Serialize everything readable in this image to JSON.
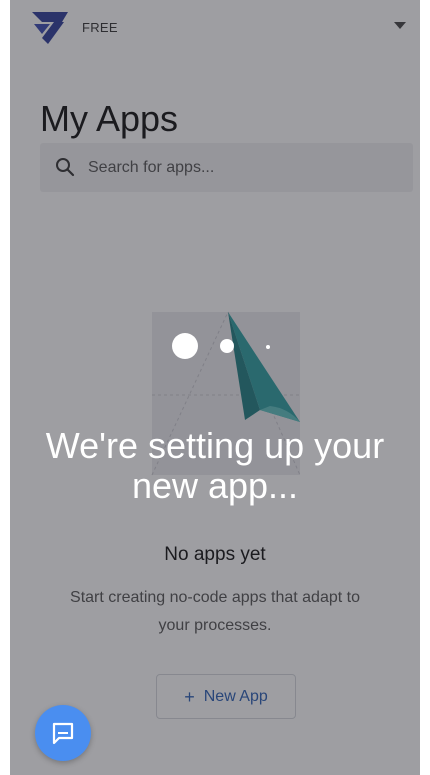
{
  "header": {
    "plan_label": "FREE",
    "logo_icon": "app-logo-icon",
    "account_menu_icon": "caret-down-icon"
  },
  "main": {
    "title": "My Apps",
    "search": {
      "placeholder": "Search for apps...",
      "value": "",
      "icon": "search-icon"
    },
    "empty_state": {
      "illustration": "folded-paper-illustration",
      "title": "No apps yet",
      "description": "Start creating no-code apps that adapt to your processes.",
      "new_app_button": {
        "icon": "+",
        "label": "New App"
      }
    }
  },
  "overlay": {
    "message": "We're setting up your new app...",
    "loader_icon": "loading-dots-icon"
  },
  "chat": {
    "icon": "chat-bubble-icon"
  },
  "colors": {
    "brand_logo": "#2f3d9a",
    "accent": "#2b5fb5",
    "chat_fab": "#4a8ef0",
    "illustration_fold": "#2d9ea0"
  }
}
